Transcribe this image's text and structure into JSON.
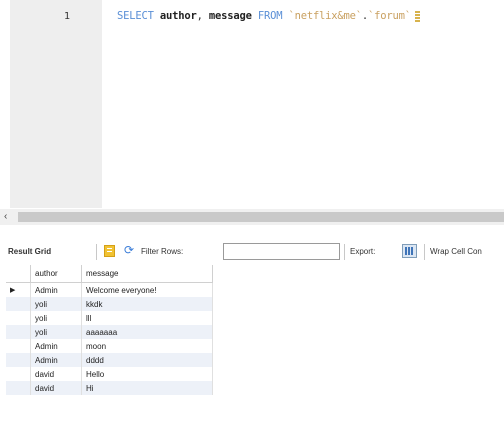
{
  "editor": {
    "line_number": "1",
    "code": {
      "kw_select": "SELECT",
      "col_author": "author",
      "comma": ",",
      "col_message": "message",
      "kw_from": "FROM",
      "schema": "`netflix&me`",
      "dot": ".",
      "table": "`forum`"
    }
  },
  "toolbar": {
    "result_grid_label": "Result Grid",
    "filter_rows_label": "Filter Rows:",
    "filter_value": "",
    "export_label": "Export:",
    "wrap_label": "Wrap Cell Con"
  },
  "grid": {
    "columns": [
      "author",
      "message"
    ],
    "rows": [
      {
        "author": "Admin",
        "message": "Welcome everyone!",
        "current": true
      },
      {
        "author": "yoli",
        "message": "kkdk"
      },
      {
        "author": "yoli",
        "message": "lll"
      },
      {
        "author": "yoli",
        "message": "aaaaaaa"
      },
      {
        "author": "Admin",
        "message": "moon"
      },
      {
        "author": "Admin",
        "message": "dddd"
      },
      {
        "author": "david",
        "message": "Hello"
      },
      {
        "author": "david",
        "message": "Hi"
      }
    ]
  },
  "icons": {
    "current_row_indicator": "▶",
    "scroll_left": "‹",
    "refresh": "⟳"
  },
  "colors": {
    "keyword": "#5a8fd6",
    "string": "#c9a060",
    "alt_row": "#edf1f8"
  }
}
